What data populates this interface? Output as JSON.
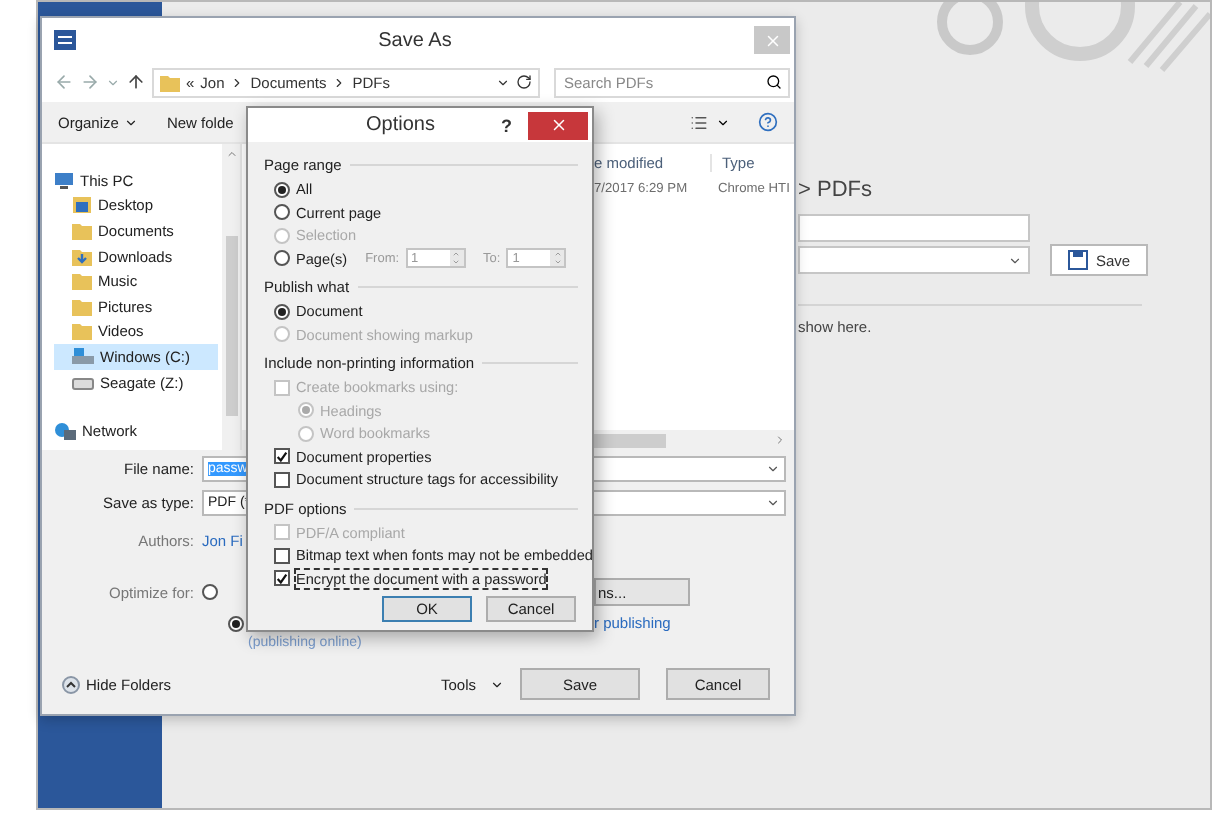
{
  "word_window": {
    "backstage": {
      "path": "> PDFs",
      "save_button": "Save",
      "hint": "show here."
    }
  },
  "save_as": {
    "title": "Save As",
    "breadcrumb": {
      "overflow": "«",
      "parts": [
        "Jon",
        "Documents",
        "PDFs"
      ]
    },
    "search": {
      "placeholder": "Search PDFs"
    },
    "toolbar": {
      "organize": "Organize",
      "new_folder": "New folde"
    },
    "nav_items": [
      {
        "kind": "pc",
        "label": "This PC",
        "selected": false
      },
      {
        "kind": "desktop",
        "label": "Desktop",
        "selected": false
      },
      {
        "kind": "folder",
        "label": "Documents",
        "selected": false
      },
      {
        "kind": "download",
        "label": "Downloads",
        "selected": false
      },
      {
        "kind": "folder",
        "label": "Music",
        "selected": false
      },
      {
        "kind": "folder",
        "label": "Pictures",
        "selected": false
      },
      {
        "kind": "folder",
        "label": "Videos",
        "selected": false
      },
      {
        "kind": "drive",
        "label": "Windows (C:)",
        "selected": true
      },
      {
        "kind": "external",
        "label": "Seagate (Z:)",
        "selected": false
      },
      {
        "kind": "network",
        "label": "Network",
        "selected": false
      }
    ],
    "table": {
      "columns": [
        "e modified",
        "Type"
      ],
      "rows": [
        [
          "7/2017 6:29 PM",
          "Chrome HTI"
        ]
      ]
    },
    "form": {
      "file_name": {
        "label": "File name:",
        "value": "passw"
      },
      "save_as_type": {
        "label": "Save as type:",
        "value": "PDF (*"
      },
      "authors": {
        "label": "Authors:",
        "value": "Jon Fi"
      },
      "optimize": {
        "label": "Optimize for:",
        "options": [
          {
            "selected": false
          },
          {
            "selected": true
          }
        ]
      },
      "options_button": "ns...",
      "link": "r publishing",
      "note": "(publishing online)"
    },
    "footer": {
      "hide_folders": "Hide Folders",
      "tools": "Tools",
      "save": "Save",
      "cancel": "Cancel"
    }
  },
  "options": {
    "title": "Options",
    "help": "?",
    "sections": [
      {
        "title": "Page range",
        "items": [
          {
            "kind": "radio",
            "label": "All",
            "selected": true,
            "disabled": false,
            "focused": false
          },
          {
            "kind": "radio",
            "label": "Current page",
            "selected": false,
            "disabled": false,
            "focused": false
          },
          {
            "kind": "radio",
            "label": "Selection",
            "selected": false,
            "disabled": true,
            "focused": false
          },
          {
            "kind": "range",
            "label": "Page(s)",
            "selected": false,
            "disabled": false,
            "focused": false,
            "from_label": "From:",
            "from": "1",
            "to_label": "To:",
            "to": "1"
          }
        ]
      },
      {
        "title": "Publish what",
        "items": [
          {
            "kind": "radio",
            "label": "Document",
            "selected": true,
            "disabled": false,
            "focused": false
          },
          {
            "kind": "radio",
            "label": "Document showing markup",
            "selected": false,
            "disabled": true,
            "focused": false
          }
        ]
      },
      {
        "title": "Include non-printing information",
        "items": [
          {
            "kind": "checkbox",
            "label": "Create bookmarks using:",
            "checked": false,
            "disabled": true,
            "focused": false,
            "children": [
              {
                "kind": "radio",
                "label": "Headings",
                "selected": true,
                "disabled": true,
                "focused": false
              },
              {
                "kind": "radio",
                "label": "Word bookmarks",
                "selected": false,
                "disabled": true,
                "focused": false
              }
            ]
          },
          {
            "kind": "checkbox",
            "label": "Document properties",
            "checked": true,
            "disabled": false,
            "focused": false
          },
          {
            "kind": "checkbox",
            "label": "Document structure tags for accessibility",
            "checked": false,
            "disabled": false,
            "focused": false
          }
        ]
      },
      {
        "title": "PDF options",
        "items": [
          {
            "kind": "checkbox",
            "label": "PDF/A compliant",
            "checked": false,
            "disabled": true,
            "focused": false
          },
          {
            "kind": "checkbox",
            "label": "Bitmap text when fonts may not be embedded",
            "checked": false,
            "disabled": false,
            "focused": false
          },
          {
            "kind": "checkbox",
            "label": "Encrypt the document with a password",
            "checked": true,
            "disabled": false,
            "focused": true
          }
        ]
      }
    ],
    "buttons": {
      "ok": "OK",
      "cancel": "Cancel"
    }
  }
}
